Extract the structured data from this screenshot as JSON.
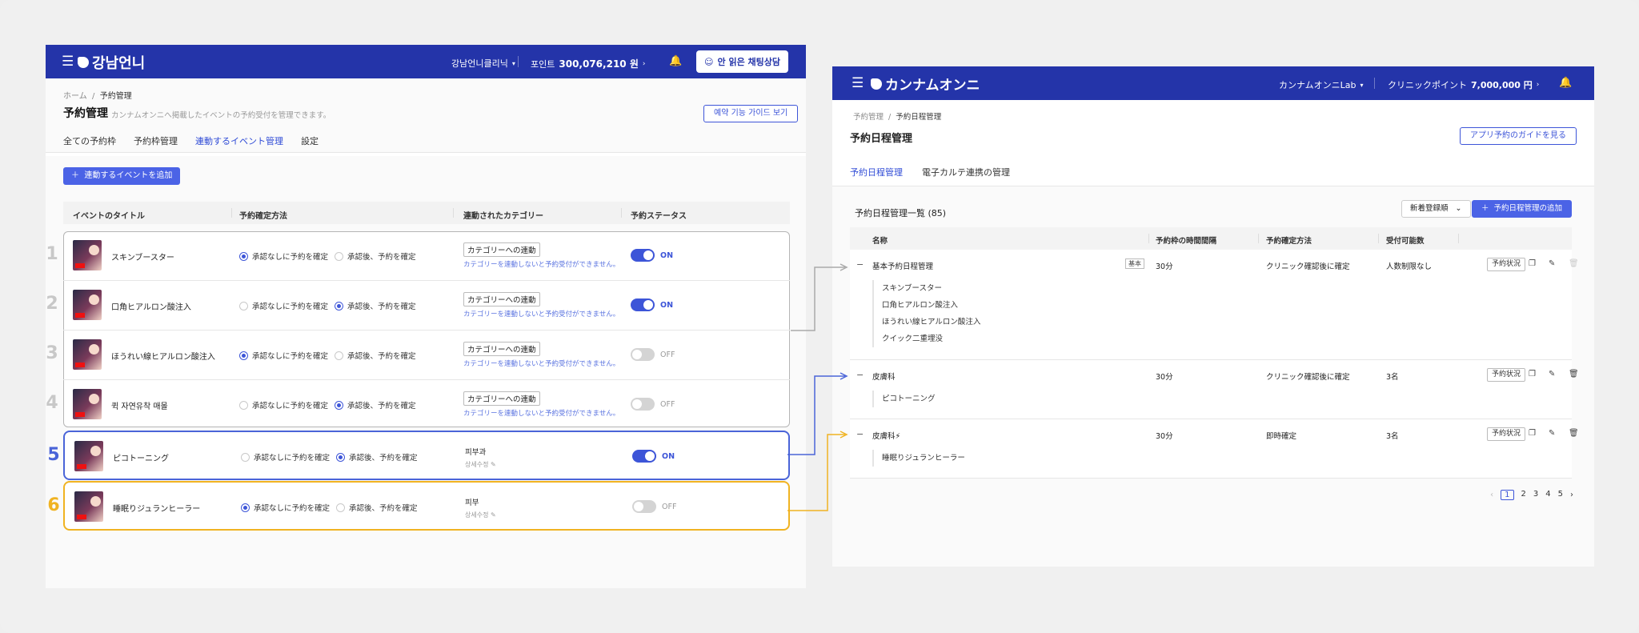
{
  "left": {
    "header": {
      "logo_text": "강남언니",
      "clinic": "강남언니클리닉",
      "points_label": "포인트",
      "points_value": "300,076,210 원",
      "chat_button": "안 읽은 채팅상담"
    },
    "breadcrumb": {
      "home": "ホーム",
      "current": "予約管理"
    },
    "page_title": "予約管理",
    "page_desc": "カンナムオンニへ掲載したイベントの予約受付を管理できます。",
    "guide_button": "예약 기능 가이드 보기",
    "tabs": [
      "全ての予約枠",
      "予約枠管理",
      "連動するイベント管理",
      "設定"
    ],
    "active_tab": 2,
    "add_button": "連動するイベントを追加",
    "columns": [
      "イベントのタイトル",
      "予約確定方法",
      "連動されたカテゴリー",
      "予約ステータス"
    ],
    "radio_options": [
      "承認なしに予約を確定",
      "承認後、予約を確定"
    ],
    "category_link": "カテゴリーへの連動",
    "category_hint": "カテゴリーを連動しないと予約受付ができません。",
    "category_edit": "상세수정",
    "rows": [
      {
        "num": "1",
        "title": "スキンブースター",
        "method": 0,
        "category": "",
        "status": "ON"
      },
      {
        "num": "2",
        "title": "口角ヒアルロン酸注入",
        "method": 1,
        "category": "",
        "status": "ON"
      },
      {
        "num": "3",
        "title": "ほうれい線ヒアルロン酸注入",
        "method": 0,
        "category": "",
        "status": "OFF"
      },
      {
        "num": "4",
        "title": "퀵 자연유착 매몰",
        "method": 1,
        "category": "",
        "status": "OFF"
      },
      {
        "num": "5",
        "title": "ピコトーニング",
        "method": 1,
        "category": "피부과",
        "status": "ON"
      },
      {
        "num": "6",
        "title": "睡眠りジュランヒーラー",
        "method": 0,
        "category": "피부",
        "status": "OFF"
      }
    ]
  },
  "right": {
    "header": {
      "logo_text": "カンナムオンニ",
      "clinic": "カンナムオンニLab",
      "points_label": "クリニックポイント",
      "points_value": "7,000,000 円"
    },
    "breadcrumb": {
      "parent": "予約管理",
      "current": "予約日程管理"
    },
    "page_title": "予約日程管理",
    "guide_button": "アプリ予約のガイドを見る",
    "tabs": [
      "予約日程管理",
      "電子カルテ連携の管理"
    ],
    "list_title": "予約日程管理一覧 (85)",
    "sort_label": "新着登録順",
    "add_button": "予約日程管理の追加",
    "columns": [
      "名称",
      "予約枠の時間間隔",
      "予約確定方法",
      "受付可能数"
    ],
    "status_button": "予約状況",
    "schedules": [
      {
        "name": "基本予約日程管理",
        "badge": "基本",
        "interval": "30分",
        "method": "クリニック確認後に確定",
        "capacity": "人数制限なし",
        "children": [
          "スキンブースター",
          "口角ヒアルロン酸注入",
          "ほうれい線ヒアルロン酸注入",
          "クイック二重埋没"
        ]
      },
      {
        "name": "皮膚科",
        "badge": "",
        "interval": "30分",
        "method": "クリニック確認後に確定",
        "capacity": "3名",
        "children": [
          "ピコトーニング"
        ]
      },
      {
        "name": "皮膚科⚡",
        "badge": "",
        "interval": "30分",
        "method": "即時確定",
        "capacity": "3名",
        "children": [
          "睡眠りジュランヒーラー"
        ]
      }
    ],
    "pagination": [
      "1",
      "2",
      "3",
      "4",
      "5"
    ]
  },
  "colors": {
    "header_blue": "#2434a9",
    "accent": "#3d55d8",
    "group_gray": "#b5b5b5",
    "highlight_blue": "#4a64d8",
    "highlight_yellow": "#f0b322"
  }
}
